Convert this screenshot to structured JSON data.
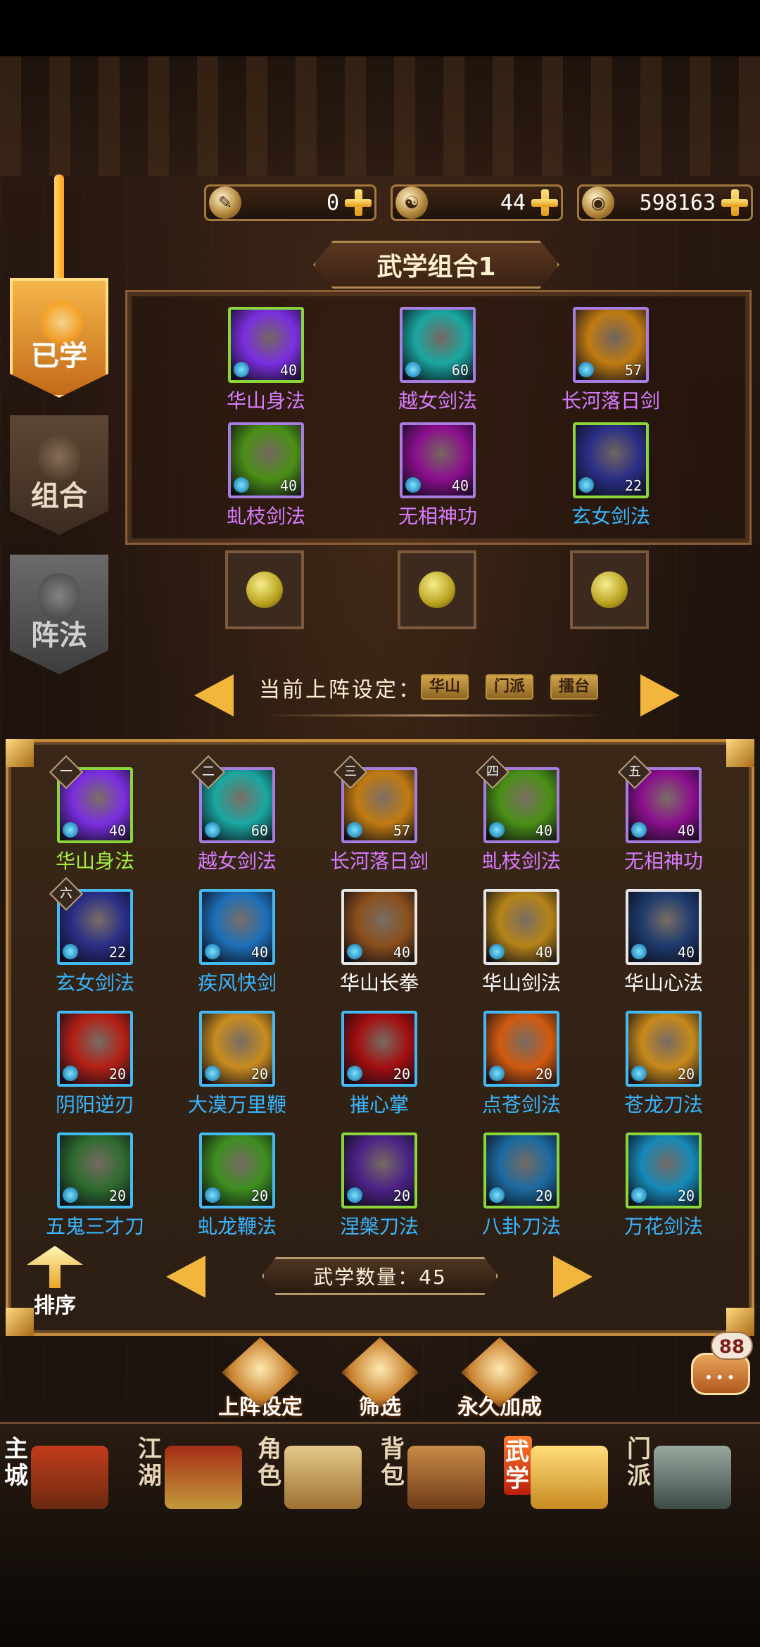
{
  "currency": [
    {
      "icon": "sword-scroll-icon",
      "value": "0"
    },
    {
      "icon": "jade-token-icon",
      "value": "44"
    },
    {
      "icon": "silver-coin-icon",
      "value": "598163"
    }
  ],
  "combo_title": "武学组合1",
  "side_tabs": {
    "learned": "已学",
    "combo": "组合",
    "formation": "阵法"
  },
  "combo_skills": [
    {
      "name": "华山身法",
      "level": "40",
      "frame": "green",
      "name_color": "purple",
      "art": "#7b2ee0"
    },
    {
      "name": "越女剑法",
      "level": "60",
      "frame": "purple",
      "name_color": "purple",
      "art": "#1aa7a1"
    },
    {
      "name": "长河落日剑",
      "level": "57",
      "frame": "purple",
      "name_color": "purple",
      "art": "#c07b12"
    },
    {
      "name": "虬枝剑法",
      "level": "40",
      "frame": "purple",
      "name_color": "purple",
      "art": "#4a8f16"
    },
    {
      "name": "无相神功",
      "level": "40",
      "frame": "purple",
      "name_color": "purple",
      "art": "#8b0f8d"
    },
    {
      "name": "玄女剑法",
      "level": "22",
      "frame": "green",
      "name_color": "blue",
      "art": "#2b2f86"
    }
  ],
  "formation": {
    "label": "当前上阵设定：",
    "tags": [
      "华山",
      "门派",
      "擂台"
    ]
  },
  "skills": [
    {
      "rank": "一",
      "name": "华山身法",
      "level": "40",
      "frame": "green",
      "name_color": "green",
      "art": "#7b2ee0"
    },
    {
      "rank": "二",
      "name": "越女剑法",
      "level": "60",
      "frame": "purple",
      "name_color": "purple",
      "art": "#1aa7a1"
    },
    {
      "rank": "三",
      "name": "长河落日剑",
      "level": "57",
      "frame": "purple",
      "name_color": "purple",
      "art": "#c07b12"
    },
    {
      "rank": "四",
      "name": "虬枝剑法",
      "level": "40",
      "frame": "purple",
      "name_color": "purple",
      "art": "#4a8f16"
    },
    {
      "rank": "五",
      "name": "无相神功",
      "level": "40",
      "frame": "purple",
      "name_color": "purple",
      "art": "#8b0f8d"
    },
    {
      "rank": "六",
      "name": "玄女剑法",
      "level": "22",
      "frame": "blue",
      "name_color": "blue",
      "art": "#2b2f86"
    },
    {
      "rank": "",
      "name": "疾风快剑",
      "level": "40",
      "frame": "blue",
      "name_color": "blue",
      "art": "#1d6fb8"
    },
    {
      "rank": "",
      "name": "华山长拳",
      "level": "40",
      "frame": "white",
      "name_color": "white",
      "art": "#8a4f1c"
    },
    {
      "rank": "",
      "name": "华山剑法",
      "level": "40",
      "frame": "white",
      "name_color": "white",
      "art": "#b58318"
    },
    {
      "rank": "",
      "name": "华山心法",
      "level": "40",
      "frame": "white",
      "name_color": "white",
      "art": "#1f3b6e"
    },
    {
      "rank": "",
      "name": "阴阳逆刃",
      "level": "20",
      "frame": "blue",
      "name_color": "blue",
      "art": "#b32016"
    },
    {
      "rank": "",
      "name": "大漠万里鞭",
      "level": "20",
      "frame": "blue",
      "name_color": "blue",
      "art": "#c88c1f"
    },
    {
      "rank": "",
      "name": "摧心掌",
      "level": "20",
      "frame": "blue",
      "name_color": "blue",
      "art": "#a30f10"
    },
    {
      "rank": "",
      "name": "点苍剑法",
      "level": "20",
      "frame": "blue",
      "name_color": "blue",
      "art": "#d05a10"
    },
    {
      "rank": "",
      "name": "苍龙刀法",
      "level": "20",
      "frame": "blue",
      "name_color": "blue",
      "art": "#c7891b"
    },
    {
      "rank": "",
      "name": "五鬼三才刀",
      "level": "20",
      "frame": "blue",
      "name_color": "blue",
      "art": "#2f6b2f"
    },
    {
      "rank": "",
      "name": "虬龙鞭法",
      "level": "20",
      "frame": "blue",
      "name_color": "blue",
      "art": "#3d8e1f"
    },
    {
      "rank": "",
      "name": "涅槃刀法",
      "level": "20",
      "frame": "green",
      "name_color": "blue",
      "art": "#4c2386"
    },
    {
      "rank": "",
      "name": "八卦刀法",
      "level": "20",
      "frame": "green",
      "name_color": "blue",
      "art": "#1c6aa0"
    },
    {
      "rank": "",
      "name": "万花剑法",
      "level": "20",
      "frame": "green",
      "name_color": "blue",
      "art": "#1689b8"
    }
  ],
  "sort_label": "排序",
  "skill_count": "武学数量：45",
  "bottom_buttons": [
    "上阵设定",
    "筛选",
    "永久加成"
  ],
  "chat_count": "88",
  "chat_dots": "•••",
  "nav": [
    {
      "label": "主城",
      "icon": "palace-icon"
    },
    {
      "label": "江湖",
      "icon": "flag-icon"
    },
    {
      "label": "角色",
      "icon": "scroll-icon"
    },
    {
      "label": "背包",
      "icon": "bag-icon"
    },
    {
      "label": "武学",
      "icon": "martial-scroll-icon"
    },
    {
      "label": "门派",
      "icon": "cauldron-icon"
    }
  ]
}
